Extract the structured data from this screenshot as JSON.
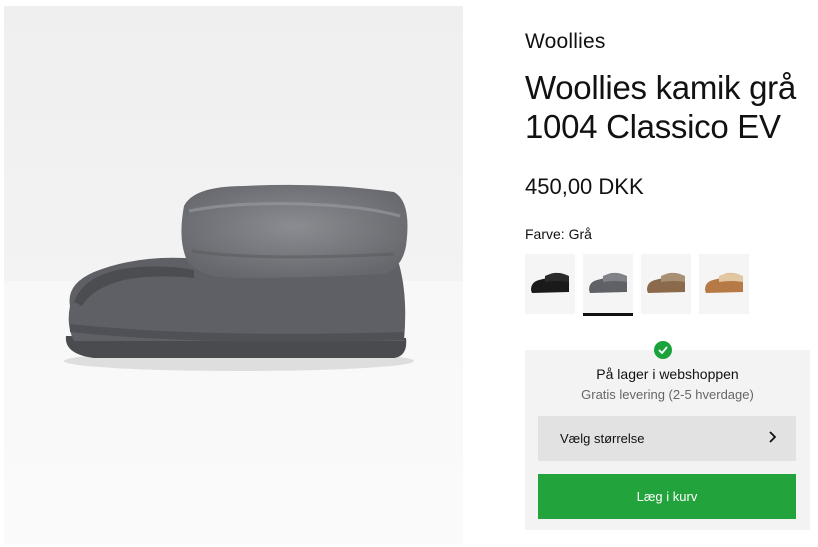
{
  "product": {
    "brand": "Woollies",
    "title": "Woollies kamik grå 1004 Classico EV",
    "price": "450,00 DKK",
    "color_line": "Farve: Grå"
  },
  "swatches": [
    {
      "name": "black",
      "color": "#1a1a1a",
      "cuff": "#2a2a2a"
    },
    {
      "name": "grey",
      "color": "#5f6166",
      "cuff": "#808287",
      "selected": true
    },
    {
      "name": "brown",
      "color": "#8a6a4a",
      "cuff": "#a98f73"
    },
    {
      "name": "chestnut",
      "color": "#b57a45",
      "cuff": "#e2c7a3"
    }
  ],
  "stock": {
    "title": "På lager i webshoppen",
    "subtitle": "Gratis levering (2-5 hverdage)",
    "size_label": "Vælg størrelse",
    "add_label": "Læg i kurv"
  },
  "colors": {
    "accent_green": "#22a33b",
    "check_green": "#1aa33a"
  }
}
